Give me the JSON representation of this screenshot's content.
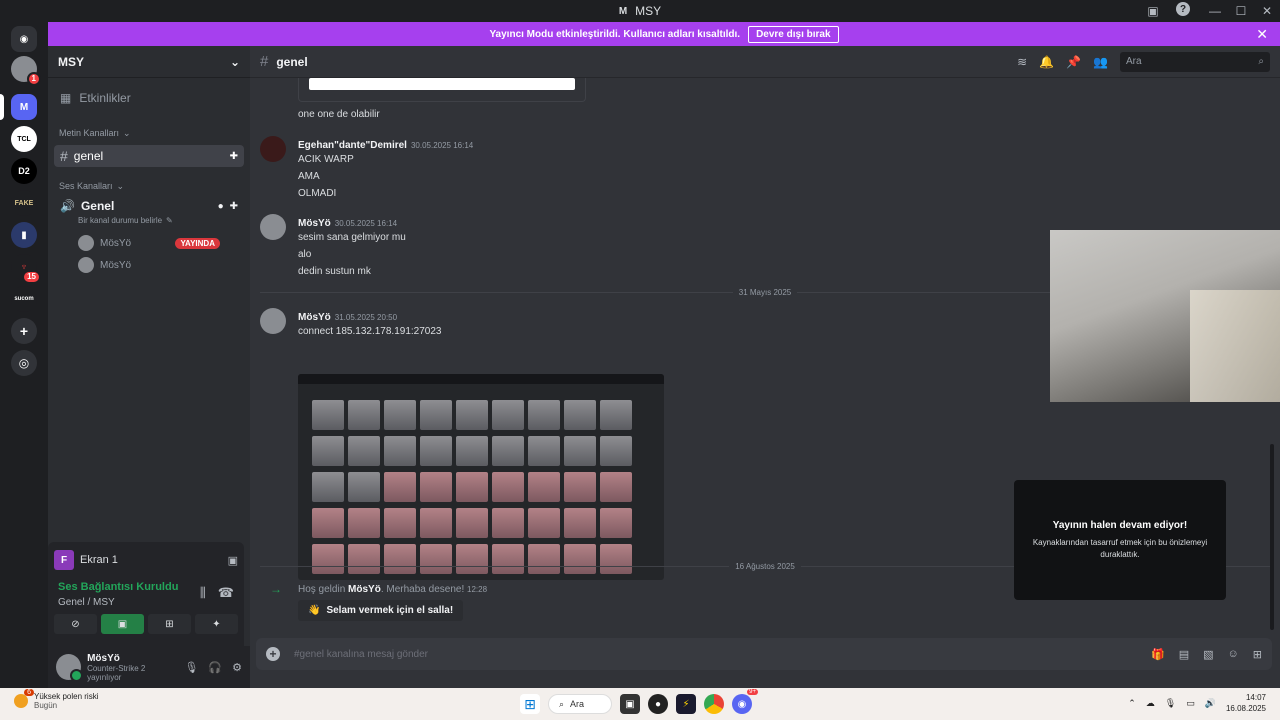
{
  "window": {
    "title": "MSY",
    "icon_letter": "M",
    "controls": [
      "—",
      "☐",
      "✕"
    ]
  },
  "banner": {
    "text": "Yayıncı Modu etkinleştirildi. Kullanıcı adları kısaltıldı.",
    "button": "Devre dışı bırak"
  },
  "guilds": [
    {
      "label": "",
      "badge": "1"
    },
    {
      "label": "M"
    },
    {
      "label": "TCL"
    },
    {
      "label": "D2"
    },
    {
      "label": "FAKE"
    },
    {
      "label": "15"
    },
    {
      "label": "sucom"
    }
  ],
  "server": {
    "name": "MSY",
    "events": "Etkinlikler",
    "text_category": "Metin Kanalları",
    "active_channel": "genel",
    "voice_category": "Ses Kanalları",
    "voice_channel": "Genel",
    "voice_status_placeholder": "Bir kanal durumu belirle",
    "voice_users": [
      {
        "name": "MösYö",
        "live": "YAYINDA"
      },
      {
        "name": "MösYö",
        "live": ""
      }
    ]
  },
  "panel": {
    "screen": "Ekran 1",
    "connection": "Ses Bağlantısı Kuruldu",
    "location": "Genel / MSY"
  },
  "user": {
    "name": "MösYö",
    "status": "Counter-Strike 2 yayınlıyor"
  },
  "channel": {
    "name": "genel",
    "search_placeholder": "Ara",
    "composer_placeholder": "#genel kanalına mesaj gönder"
  },
  "messages": [
    {
      "author": "",
      "time": "",
      "lines": [
        "one one de olabilir"
      ]
    },
    {
      "author": "Egehan\"dante\"Demirel",
      "time": "30.05.2025 16:14",
      "lines": [
        "ACIK WARP",
        "AMA",
        "OLMADI"
      ]
    },
    {
      "author": "MösYö",
      "time": "30.05.2025 16:14",
      "lines": [
        "sesim sana gelmiyor mu",
        "alo",
        "dedin sustun mk"
      ]
    },
    {
      "author": "MösYö",
      "time": "31.05.2025 20:50",
      "lines": [
        "connect 185.132.178.191:27023"
      ]
    }
  ],
  "dividers": [
    "31 Mayıs 2025",
    "16 Ağustos 2025"
  ],
  "welcome": {
    "prefix": "Hoş geldin",
    "name": "MösYö",
    "suffix": ". Merhaba desene!",
    "time": "12:28",
    "button": "Selam vermek için el salla!"
  },
  "stream_overlay": {
    "heading": "Yayının halen devam ediyor!",
    "text": "Kaynaklarından tasarruf etmek için bu önizlemeyi duraklattık."
  },
  "taskbar": {
    "weather_title": "Yüksek polen riski",
    "weather_sub": "Bugün",
    "weather_badge": "6",
    "search": "Ara",
    "time": "14:07",
    "date": "16.08.2025",
    "discord_badge": "9+"
  }
}
